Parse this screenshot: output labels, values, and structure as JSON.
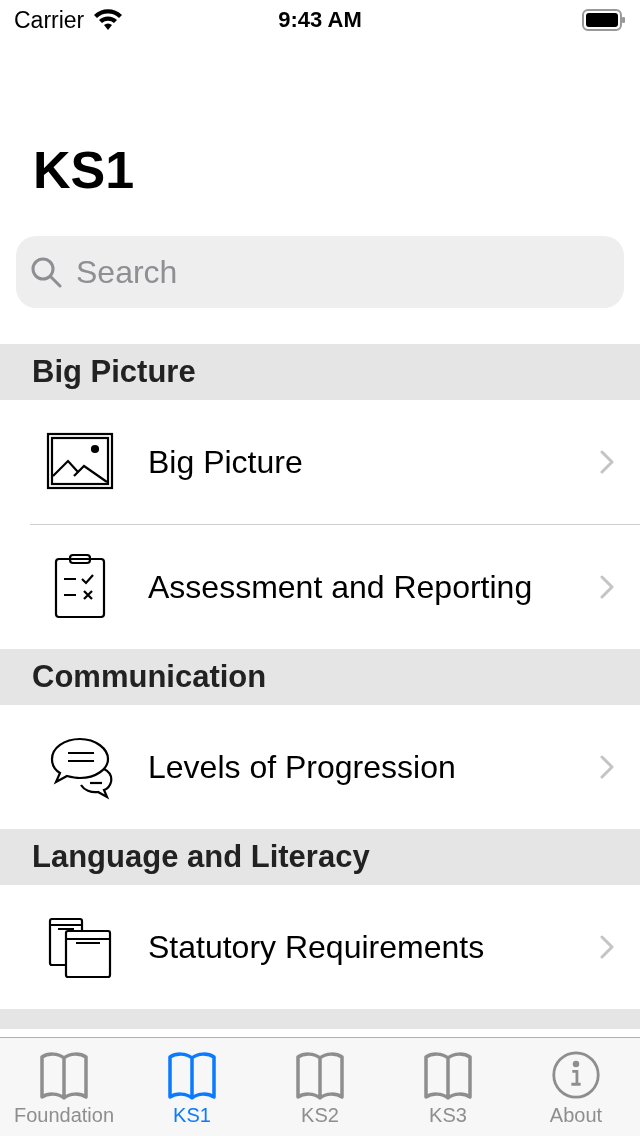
{
  "status_bar": {
    "carrier": "Carrier",
    "time": "9:43 AM"
  },
  "title": "KS1",
  "search": {
    "placeholder": "Search"
  },
  "sections": [
    {
      "header": "Big Picture",
      "items": [
        {
          "label": "Big Picture"
        },
        {
          "label": "Assessment and Reporting"
        }
      ]
    },
    {
      "header": "Communication",
      "items": [
        {
          "label": "Levels of Progression"
        }
      ]
    },
    {
      "header": "Language and Literacy",
      "items": [
        {
          "label": "Statutory Requirements"
        }
      ]
    }
  ],
  "tabs": [
    {
      "label": "Foundation",
      "selected": false
    },
    {
      "label": "KS1",
      "selected": true
    },
    {
      "label": "KS2",
      "selected": false
    },
    {
      "label": "KS3",
      "selected": false
    },
    {
      "label": "About",
      "selected": false
    }
  ]
}
